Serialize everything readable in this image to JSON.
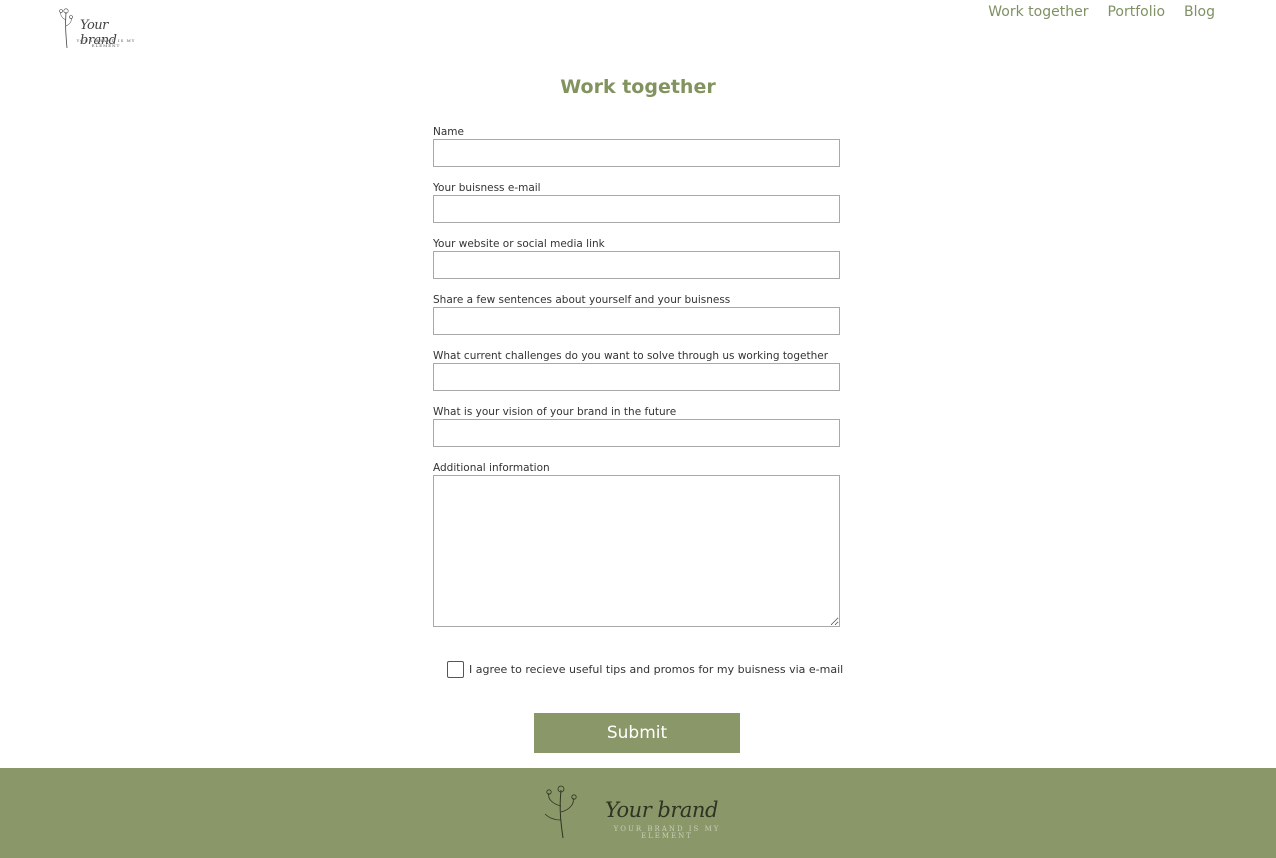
{
  "header": {
    "logo": {
      "script": "Your brand",
      "tagline": "YOUR BRAND IS MY ELEMENT"
    },
    "nav": [
      {
        "label": "Work together"
      },
      {
        "label": "Portfolio"
      },
      {
        "label": "Blog"
      }
    ]
  },
  "page_title": "Work together",
  "form": {
    "fields": [
      {
        "label": "Name",
        "value": ""
      },
      {
        "label": "Your buisness e-mail",
        "value": ""
      },
      {
        "label": "Your website or social media link",
        "value": ""
      },
      {
        "label": "Share a few sentences about yourself and your buisness",
        "value": ""
      },
      {
        "label": "What current challenges do you want to solve through us working together",
        "value": ""
      },
      {
        "label": "What is your vision of your brand in the future",
        "value": ""
      },
      {
        "label": "Additional information",
        "value": ""
      }
    ],
    "agree_label": "I agree to recieve useful tips and promos for my buisness via e-mail",
    "agree_checked": false,
    "submit_label": "Submit"
  },
  "footer": {
    "logo": {
      "script": "Your brand",
      "tagline": "YOUR BRAND IS MY ELEMENT"
    }
  },
  "colors": {
    "accent": "#82935f",
    "footer_bg": "#8a9869",
    "button_bg": "#8a9869"
  }
}
